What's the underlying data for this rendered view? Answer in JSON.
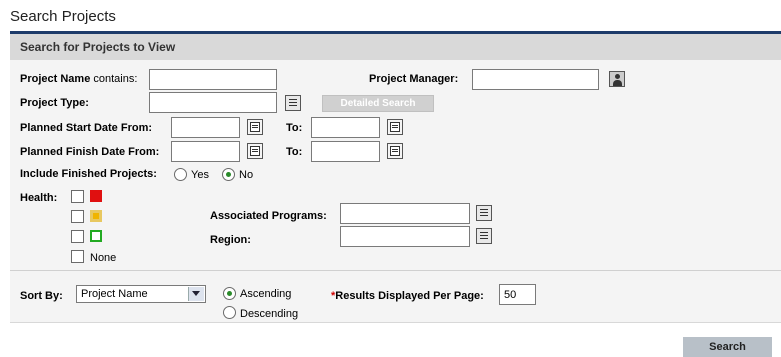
{
  "page_title": "Search Projects",
  "panel": {
    "header": "Search for Projects to View"
  },
  "fields": {
    "project_name": {
      "label": "Project Name",
      "label_suffix": "contains:",
      "value": ""
    },
    "project_manager": {
      "label": "Project Manager:",
      "value": "",
      "icon": "person-icon"
    },
    "project_type": {
      "label": "Project Type:",
      "value": "",
      "icon": "list-icon"
    },
    "detailed_search": {
      "label": "Detailed Search",
      "state": "disabled"
    },
    "planned_start": {
      "label": "Planned Start Date From:",
      "to_label": "To:",
      "from_value": "",
      "to_value": "",
      "icon": "calendar-icon"
    },
    "planned_finish": {
      "label": "Planned Finish Date From:",
      "to_label": "To:",
      "from_value": "",
      "to_value": "",
      "icon": "calendar-icon"
    },
    "include_finished": {
      "label": "Include Finished Projects:",
      "options": [
        "Yes",
        "No"
      ],
      "selected": "No"
    },
    "health": {
      "label": "Health:",
      "options": [
        {
          "color": "#e01010",
          "style": "filled",
          "checked": false
        },
        {
          "color": "#f0b400",
          "style": "bordered",
          "checked": false
        },
        {
          "color": "#22aa22",
          "style": "outline",
          "checked": false
        },
        {
          "label": "None",
          "checked": false
        }
      ]
    },
    "associated_programs": {
      "label": "Associated Programs:",
      "value": "",
      "icon": "list-icon"
    },
    "region": {
      "label": "Region:",
      "value": "",
      "icon": "list-icon"
    }
  },
  "sort": {
    "label": "Sort By:",
    "selected": "Project Name",
    "order_options": [
      "Ascending",
      "Descending"
    ],
    "order_selected": "Ascending"
  },
  "results_per_page": {
    "required_marker": "*",
    "label": "Results Displayed Per Page:",
    "value": "50"
  },
  "search_button": "Search",
  "colors": {
    "header_band": "#d9d9d9",
    "header_rule": "#1d3b6a",
    "panel_bg": "#f4f4f4",
    "radio_selected": "#2a8a2a"
  }
}
